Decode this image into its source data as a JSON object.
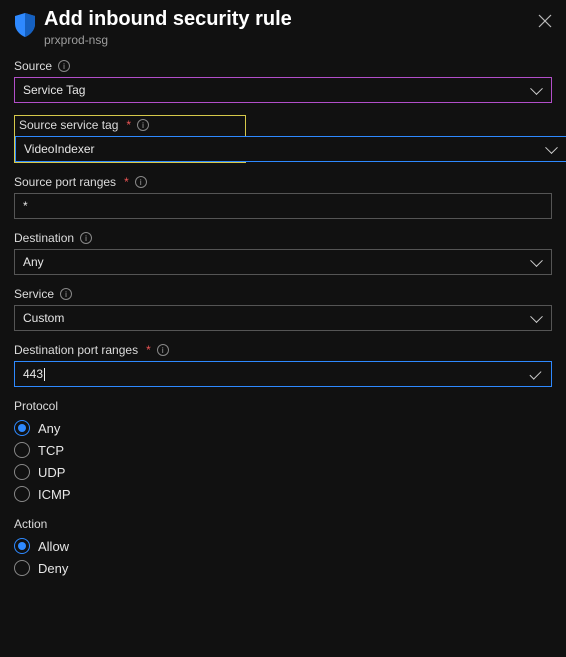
{
  "header": {
    "title": "Add inbound security rule",
    "subtitle": "prxprod-nsg"
  },
  "source": {
    "label": "Source",
    "value": "Service Tag"
  },
  "sourceServiceTag": {
    "label": "Source service tag",
    "required": "*",
    "value": "VideoIndexer"
  },
  "sourcePortRanges": {
    "label": "Source port ranges",
    "required": "*",
    "value": "*"
  },
  "destination": {
    "label": "Destination",
    "value": "Any"
  },
  "service": {
    "label": "Service",
    "value": "Custom"
  },
  "destinationPortRanges": {
    "label": "Destination port ranges",
    "required": "*",
    "value": "443"
  },
  "protocol": {
    "label": "Protocol",
    "options": [
      "Any",
      "TCP",
      "UDP",
      "ICMP"
    ],
    "selected": "Any"
  },
  "action": {
    "label": "Action",
    "options": [
      "Allow",
      "Deny"
    ],
    "selected": "Allow"
  }
}
